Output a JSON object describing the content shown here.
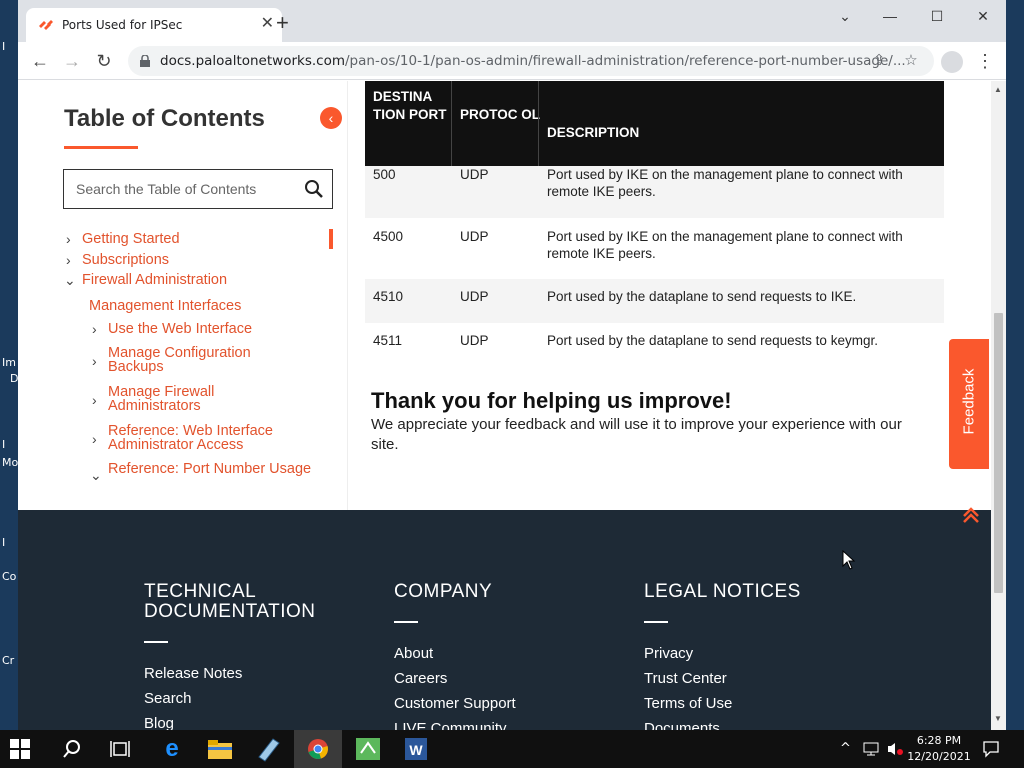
{
  "desktop": {
    "labels": [
      "I",
      "Im",
      "D",
      "I",
      "Mo",
      "I",
      "Co",
      "Cr"
    ]
  },
  "browser": {
    "tab_title": "Ports Used for IPSec",
    "url_domain": "docs.paloaltonetworks.com",
    "url_path": "/pan-os/10-1/pan-os-admin/firewall-administration/reference-port-number-usage/..."
  },
  "toc": {
    "title": "Table of Contents",
    "search_placeholder": "Search the Table of Contents",
    "items": [
      {
        "label": "Getting Started"
      },
      {
        "label": "Subscriptions"
      },
      {
        "label": "Firewall Administration"
      },
      {
        "label": "Management Interfaces"
      },
      {
        "label": "Use the Web Interface"
      },
      {
        "label": "Manage Configuration Backups"
      },
      {
        "label": "Manage Firewall Administrators"
      },
      {
        "label": "Reference: Web Interface Administrator Access"
      },
      {
        "label": "Reference: Port Number Usage"
      }
    ]
  },
  "table": {
    "headers": {
      "port": "DESTINA TION PORT",
      "protocol": "PROTOC OL",
      "description": "DESCRIPTION"
    },
    "rows": [
      {
        "port": "500",
        "protocol": "UDP",
        "description": "Port used by IKE on the management plane to connect with remote IKE peers."
      },
      {
        "port": "4500",
        "protocol": "UDP",
        "description": "Port used by IKE on the management plane to connect with remote IKE peers."
      },
      {
        "port": "4510",
        "protocol": "UDP",
        "description": "Port used by the dataplane to send requests to IKE."
      },
      {
        "port": "4511",
        "protocol": "UDP",
        "description": "Port used by the dataplane to send requests to keymgr."
      }
    ]
  },
  "feedback_msg": {
    "title": "Thank you for helping us improve!",
    "body": "We appreciate your feedback and will use it to improve your experience with our site."
  },
  "feedback_tab": "Feedback",
  "footer": {
    "col1": {
      "title": "TECHNICAL DOCUMENTATION",
      "links": [
        "Release Notes",
        "Search",
        "Blog"
      ]
    },
    "col2": {
      "title": "COMPANY",
      "links": [
        "About",
        "Careers",
        "Customer Support",
        "LIVE Community"
      ]
    },
    "col3": {
      "title": "LEGAL NOTICES",
      "links": [
        "Privacy",
        "Trust Center",
        "Terms of Use",
        "Documents"
      ]
    }
  },
  "taskbar": {
    "time": "6:28 PM",
    "date": "12/20/2021"
  },
  "colors": {
    "accent": "#fa582d",
    "footer_bg": "#1e2a36",
    "table_header_bg": "#111111"
  }
}
